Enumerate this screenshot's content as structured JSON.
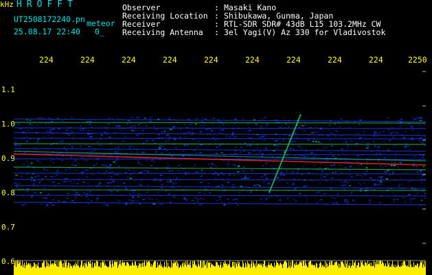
{
  "header": {
    "logo": "HROFFT",
    "filename": "UT2508172240.pn",
    "file_type": "meteor",
    "datetime": "25.08.17 22:40",
    "index": "0_",
    "labels": [
      "Observer",
      "Receiving Location",
      "Receiver",
      "Receiving Antenna"
    ],
    "separator": ":",
    "values": [
      "Masaki Kano",
      "Shibukawa, Gunma, Japan",
      "RTL-SDR SDR# 43dB L15 103.2MHz CW",
      "3el Yagi(V) Az 330 for Vladivostok"
    ]
  },
  "x_axis": {
    "unit": "",
    "ticks": [
      "224",
      "224",
      "224",
      "224",
      "224",
      "224",
      "224",
      "224",
      "224",
      "2250"
    ]
  },
  "y_axis": {
    "unit": "kHz",
    "ticks": [
      "1.1",
      "1.0",
      "0.9",
      "0.8",
      "0.7",
      "0.6"
    ]
  },
  "colors": {
    "background": "#000000",
    "header_cyan": "#00e6e6",
    "header_white": "#ffffff",
    "axis_yellow": "#ffff33",
    "signal_blue": "#1a3cff",
    "signal_green": "#22cc66",
    "signal_red": "#ff2a2a"
  }
}
